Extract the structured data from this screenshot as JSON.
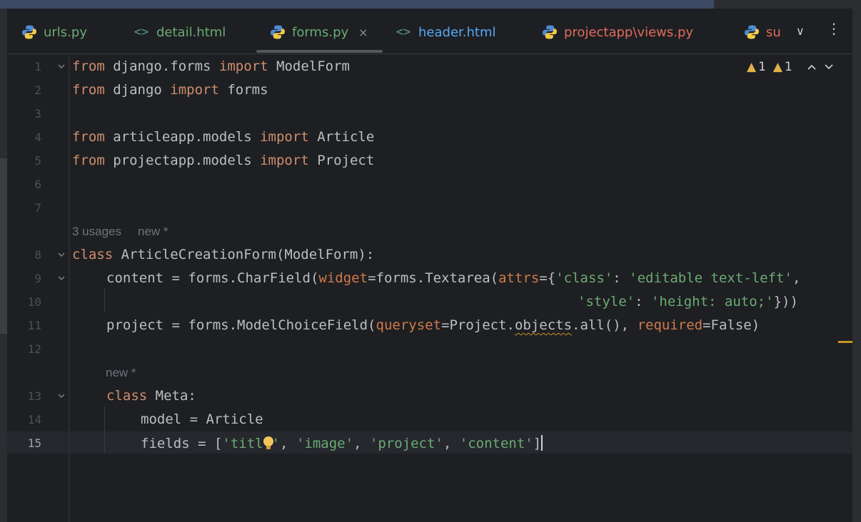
{
  "tabs": [
    {
      "label": "urls.py",
      "icon": "python-icon",
      "color": "#6aab73"
    },
    {
      "label": "detail.html",
      "icon": "html-icon",
      "color": "#6aab73"
    },
    {
      "label": "forms.py",
      "icon": "python-icon",
      "color": "#6aab73",
      "active": true
    },
    {
      "label": "header.html",
      "icon": "html-icon",
      "color": "#56a8f5"
    },
    {
      "label": "projectapp\\views.py",
      "icon": "python-icon",
      "color": "#e06c5c"
    },
    {
      "label": "su",
      "icon": "python-icon",
      "color": "#e06c5c"
    }
  ],
  "tabbar": {
    "html_glyph": "<>",
    "close_glyph": "×",
    "chevron_glyph": "∨",
    "more_glyph": "⋮"
  },
  "inspections": {
    "warnings": "1",
    "weak_warnings": "1",
    "warning_glyph": "▲"
  },
  "hints": {
    "class_usages": "3 usages",
    "class_new": "new *",
    "meta_new": "new *"
  },
  "line_numbers": [
    "1",
    "2",
    "3",
    "4",
    "5",
    "6",
    "7",
    "8",
    "9",
    "10",
    "11",
    "12",
    "13",
    "14",
    "15"
  ],
  "current_line": "15",
  "code": {
    "l1": {
      "kw1": "from",
      "mod": " django.forms ",
      "kw2": "import",
      "name": " ModelForm"
    },
    "l2": {
      "kw1": "from",
      "mod": " django ",
      "kw2": "import",
      "name": " forms"
    },
    "l4": {
      "kw1": "from",
      "mod": " articleapp.models ",
      "kw2": "import",
      "name": " Article"
    },
    "l5": {
      "kw1": "from",
      "mod": " projectapp.models ",
      "kw2": "import",
      "name": " Project"
    },
    "l8": {
      "kw": "class",
      "rest": " ArticleCreationForm(ModelForm):"
    },
    "l9": {
      "a": "content = forms.CharField(",
      "p1": "widget",
      "b": "=forms.Textarea(",
      "p2": "attrs",
      "c": "={",
      "s1": "'class'",
      "d": ": ",
      "s2": "'editable text-left'",
      "e": ","
    },
    "l10": {
      "s1": "'style'",
      "d": ": ",
      "s2": "'height: auto;'",
      "e": "}))"
    },
    "l11": {
      "a": "project = forms.ModelChoiceField(",
      "p1": "queryset",
      "b": "=Project.",
      "w": "objects",
      "c": ".all(), ",
      "p2": "required",
      "d": "=False)"
    },
    "l13": {
      "kw": "class",
      "rest": " Meta:"
    },
    "l14": {
      "a": "model = Article"
    },
    "l15": {
      "a": "fields = [",
      "s1a": "'titl",
      "s1b": "'",
      "c1": ", ",
      "s2": "'image'",
      "c2": ", ",
      "s3": "'project'",
      "c3": ", ",
      "s4": "'content'",
      "e": "]"
    }
  }
}
